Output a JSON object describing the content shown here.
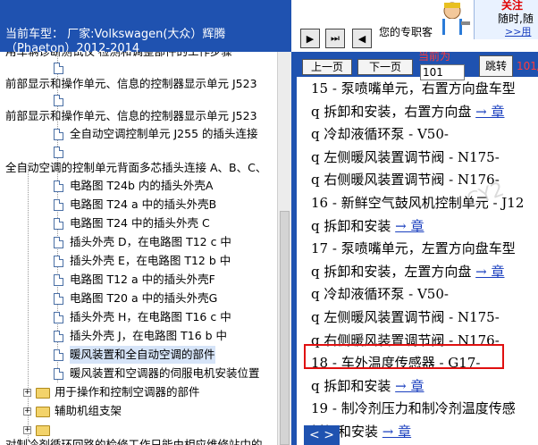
{
  "header": {
    "car_line1": "当前车型：  厂家:Volkswagen(大众）辉腾",
    "car_line2": "（Phaeton）2012-2014"
  },
  "navstrip": {
    "btn1": "▶",
    "btn2": "⏭",
    "btn3": "◀",
    "expert_text": "您的专职客",
    "ad": {
      "line1": "关注",
      "line2": "随时,随",
      "line3": ">>用"
    }
  },
  "tree": {
    "rows": [
      "用车辆诊断测试仪 检测和调整部件的工作步骤",
      "前部显示和操作单元、信息的控制器显示单元 J523",
      "前部显示和操作单元、信息的控制器显示单元 J523",
      "全自动空调控制单元 J255 的插头连接",
      "全自动空调的控制单元背面多芯插头连接 A、B、C、",
      "电路图 T24b 内的插头外壳A",
      "电路图 T24 a 中的插头外壳B",
      "电路图 T24 中的插头外壳 C",
      "插头外壳 D，在电路图 T12 c 中",
      "插头外壳 E，在电路图 T12 b 中",
      "电路图 T12 a 中的插头外壳F",
      "电路图 T20 a 中的插头外壳G",
      "插头外壳 H，在电路图 T16 c 中",
      "插头外壳 J，在电路图 T16 b 中",
      "暖风装置和全自动空调的部件",
      "暖风装置和空调器的伺服电机安装位置",
      "用于操作和控制空调器的部件",
      "辅助机组支架",
      "对制冷剂循环回路的检修工作只能由相应维修站中的"
    ]
  },
  "controls": {
    "prev_page": "上一页",
    "next_page": "下一页",
    "current_label": "当前为",
    "page_value": "101",
    "jump": "跳转",
    "page_count": "101/"
  },
  "document": {
    "lines": [
      {
        "text": "15 -  泵喷嘴单元，右置方向盘车型",
        "link": ""
      },
      {
        "text": "q   拆卸和安装，右置方向盘",
        "link": "→ 章"
      },
      {
        "text": "q   冷却液循环泵 - V50-",
        "link": ""
      },
      {
        "text": "q   左侧暖风装置调节阀 - N175-",
        "link": ""
      },
      {
        "text": "q   右侧暖风装置调节阀 - N176-",
        "link": ""
      },
      {
        "text": "16 -  新鲜空气鼓风机控制单元 - J12",
        "link": ""
      },
      {
        "text": "q   拆卸和安装",
        "link": "→ 章"
      },
      {
        "text": "17 -  泵喷嘴单元，左置方向盘车型",
        "link": ""
      },
      {
        "text": "q   拆卸和安装，左置方向盘",
        "link": "→ 章"
      },
      {
        "text": "q   冷却液循环泵 - V50-",
        "link": ""
      },
      {
        "text": "q   左侧暖风装置调节阀 - N175-",
        "link": ""
      },
      {
        "text": "q   右侧暖风装置调节阀 - N176-",
        "link": ""
      },
      {
        "text": "18 -  车外温度传感器 - G17-",
        "link": ""
      },
      {
        "text": "q   拆卸和安装",
        "link": "→ 章"
      },
      {
        "text": "19 -  制冷剂压力和制冷剂温度传感",
        "link": ""
      },
      {
        "text": "     拆卸和安装",
        "link": "→ 章"
      }
    ],
    "watermark": "CY2",
    "pager": "< >"
  },
  "colors": {
    "header_bg": "#1f52b0",
    "link": "#1a3fbf",
    "highlight": "#e01010",
    "label_red": "#ff3b3b"
  }
}
